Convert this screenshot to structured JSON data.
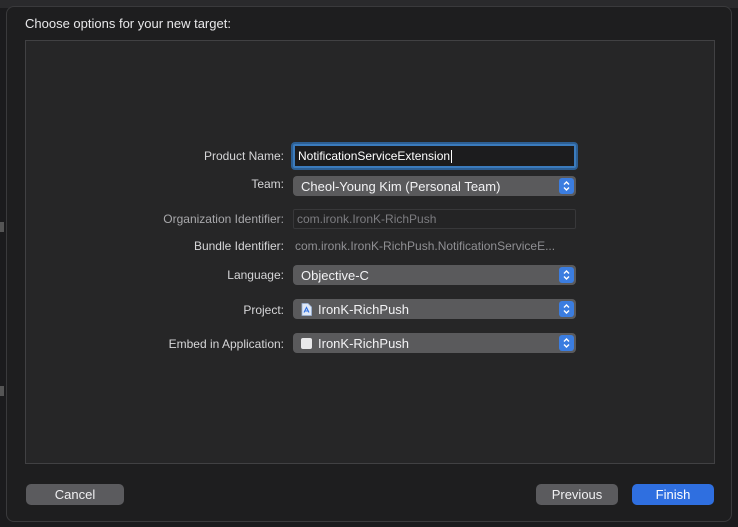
{
  "dialog": {
    "title": "Choose options for your new target:"
  },
  "form": {
    "product_name": {
      "label": "Product Name:",
      "value": "NotificationServiceExtension"
    },
    "team": {
      "label": "Team:",
      "value": "Cheol-Young Kim (Personal Team)"
    },
    "organization_identifier": {
      "label": "Organization Identifier:",
      "value": "com.ironk.IronK-RichPush"
    },
    "bundle_identifier": {
      "label": "Bundle Identifier:",
      "value": "com.ironk.IronK-RichPush.NotificationServiceE..."
    },
    "language": {
      "label": "Language:",
      "value": "Objective-C"
    },
    "project": {
      "label": "Project:",
      "value": "IronK-RichPush",
      "icon": "project-file-icon"
    },
    "embed_in_application": {
      "label": "Embed in Application:",
      "value": "IronK-RichPush",
      "icon": "app-icon"
    }
  },
  "buttons": {
    "cancel": "Cancel",
    "previous": "Previous",
    "finish": "Finish"
  },
  "colors": {
    "accent": "#2f6fe0",
    "focus_ring": "#3b7bbd",
    "popup_bg": "#5a5a5c"
  }
}
